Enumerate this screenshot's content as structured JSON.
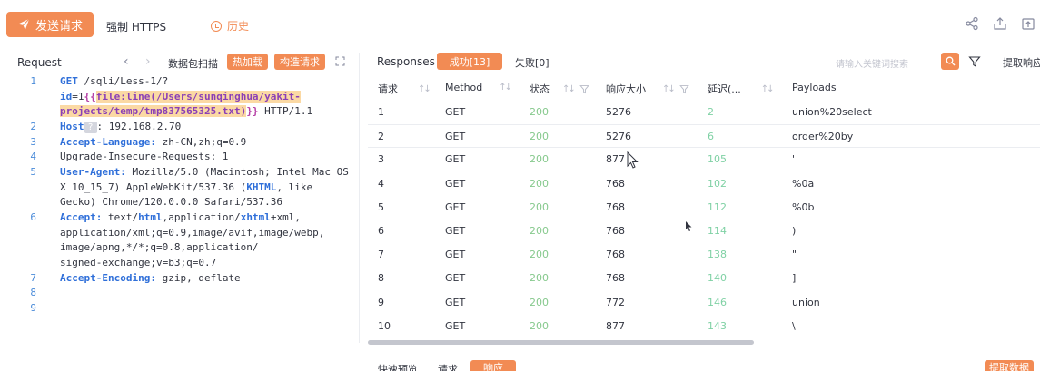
{
  "toolbar": {
    "send_label": "发送请求",
    "force_https_label": "强制 HTTPS",
    "history_label": "历史"
  },
  "request": {
    "title": "Request",
    "scan_label": "数据包扫描",
    "hot_load_label": "热加载",
    "build_label": "构造请求",
    "lines": [
      {
        "no": "1",
        "parts": [
          {
            "t": "GET",
            "c": "kw"
          },
          {
            "t": " /sqli/Less-1/?"
          },
          {
            "t": "id",
            "c": "kw2"
          },
          {
            "t": "=1"
          },
          {
            "t": "{{",
            "c": "hlb"
          },
          {
            "t": "file:line(/Users/sunqinghua/yakit-projects/temp/tmp837565325.txt)",
            "c": "hl"
          },
          {
            "t": "}}",
            "c": "hlb"
          },
          {
            "t": " HTTP/1.1"
          }
        ]
      },
      {
        "no": "2",
        "parts": [
          {
            "t": "Host",
            "c": "kw"
          },
          {
            "t": "?",
            "c": "q"
          },
          {
            "t": ": 192.168.2.70"
          }
        ]
      },
      {
        "no": "3",
        "parts": [
          {
            "t": "Accept-Language:",
            "c": "kw"
          },
          {
            "t": " zh-CN,zh;q=0.9"
          }
        ]
      },
      {
        "no": "4",
        "parts": [
          {
            "t": "Upgrade-Insecure-Requests: 1"
          }
        ]
      },
      {
        "no": "5",
        "parts": [
          {
            "t": "User-Agent:",
            "c": "kw"
          },
          {
            "t": " Mozilla/5.0 (Macintosh; Intel Mac OS X 10_15_7) AppleWebKit/537.36 ("
          },
          {
            "t": "KHTML",
            "c": "kw2"
          },
          {
            "t": ", like Gecko) Chrome/120.0.0.0 Safari/537.36"
          }
        ]
      },
      {
        "no": "6",
        "parts": [
          {
            "t": "Accept:",
            "c": "kw"
          },
          {
            "t": " text/"
          },
          {
            "t": "html",
            "c": "kw2"
          },
          {
            "t": ",application/"
          },
          {
            "t": "xhtml",
            "c": "kw2"
          },
          {
            "t": "+xml,\napplication/xml;q=0.9,image/avif,image/webp,\nimage/apng,*/*;q=0.8,application/\nsigned-exchange;v=b3;q=0.7"
          }
        ]
      },
      {
        "no": "7",
        "parts": [
          {
            "t": "Accept-Encoding:",
            "c": "kw"
          },
          {
            "t": " gzip, deflate"
          }
        ]
      },
      {
        "no": "8",
        "parts": []
      },
      {
        "no": "9",
        "parts": []
      }
    ]
  },
  "responses": {
    "title": "Responses",
    "success_tab": "成功[13]",
    "fail_tab": "失败[0]",
    "search_placeholder": "请输入关键词搜索",
    "extract_label": "提取响应",
    "columns": [
      "请求",
      "Method",
      "状态",
      "响应大小",
      "延迟(...",
      "Payloads"
    ],
    "rows": [
      {
        "id": "1",
        "method": "GET",
        "status": "200",
        "size": "5276",
        "delay": "2",
        "payload": "union%20select"
      },
      {
        "id": "2",
        "method": "GET",
        "status": "200",
        "size": "5276",
        "delay": "6",
        "payload": "order%20by"
      },
      {
        "id": "3",
        "method": "GET",
        "status": "200",
        "size": "877",
        "delay": "105",
        "payload": "'"
      },
      {
        "id": "4",
        "method": "GET",
        "status": "200",
        "size": "768",
        "delay": "102",
        "payload": "%0a"
      },
      {
        "id": "5",
        "method": "GET",
        "status": "200",
        "size": "768",
        "delay": "112",
        "payload": "%0b"
      },
      {
        "id": "6",
        "method": "GET",
        "status": "200",
        "size": "768",
        "delay": "114",
        "payload": ")"
      },
      {
        "id": "7",
        "method": "GET",
        "status": "200",
        "size": "768",
        "delay": "138",
        "payload": "\""
      },
      {
        "id": "8",
        "method": "GET",
        "status": "200",
        "size": "768",
        "delay": "140",
        "payload": "]"
      },
      {
        "id": "9",
        "method": "GET",
        "status": "200",
        "size": "772",
        "delay": "146",
        "payload": "union"
      },
      {
        "id": "10",
        "method": "GET",
        "status": "200",
        "size": "877",
        "delay": "143",
        "payload": "\\"
      }
    ]
  },
  "bottom": {
    "quick_preview": "快速预览",
    "request_tab": "请求",
    "response_tab": "响应",
    "extract_data": "提取数据"
  },
  "colors": {
    "accent": "#f28b54",
    "status": "#86c98d",
    "delay": "#7fd1a4"
  }
}
